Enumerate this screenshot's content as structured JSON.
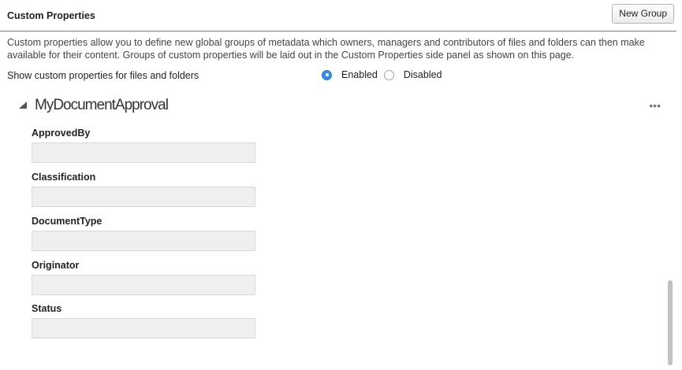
{
  "header": {
    "title": "Custom Properties",
    "new_group_label": "New Group"
  },
  "description": "Custom properties allow you to define new global groups of metadata which owners, managers and contributors of files and folders can then make available for their content. Groups of custom properties will be laid out in the Custom Properties side panel as shown on this page.",
  "show_setting": {
    "label": "Show custom properties for files and folders",
    "options": [
      {
        "label": "Enabled",
        "selected": true
      },
      {
        "label": "Disabled",
        "selected": false
      }
    ]
  },
  "group": {
    "name": "MyDocumentApproval",
    "expanded": true,
    "more_label": "•••",
    "fields": [
      {
        "label": "ApprovedBy",
        "value": ""
      },
      {
        "label": "Classification",
        "value": ""
      },
      {
        "label": "DocumentType",
        "value": ""
      },
      {
        "label": "Originator",
        "value": ""
      },
      {
        "label": "Status",
        "value": ""
      }
    ]
  },
  "colors": {
    "accent": "#3b8de0",
    "field_background": "#efefef"
  }
}
